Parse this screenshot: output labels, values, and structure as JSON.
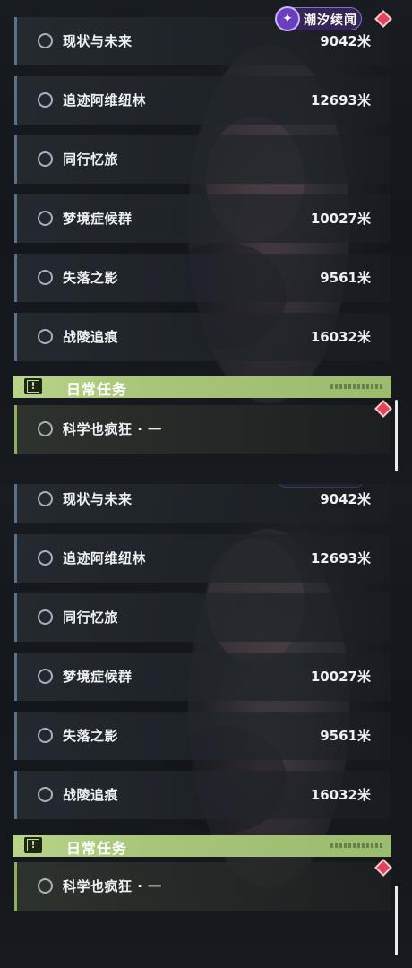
{
  "app_badge": {
    "label": "潮汐续闻",
    "logo_glyph": "✦"
  },
  "section": {
    "title": "日常任务",
    "icon_glyph": "!"
  },
  "quests": [
    {
      "name": "现状与未来",
      "distance": "9042米"
    },
    {
      "name": "追迹阿维纽林",
      "distance": "12693米"
    },
    {
      "name": "同行忆旅",
      "distance": ""
    },
    {
      "name": "梦境症候群",
      "distance": "10027米"
    },
    {
      "name": "失落之影",
      "distance": "9561米"
    },
    {
      "name": "战陵追痕",
      "distance": "16032米"
    }
  ],
  "daily_quests": [
    {
      "name": "科学也疯狂 · 一",
      "distance": ""
    }
  ],
  "colors": {
    "row_accent": "#5a7288",
    "daily_accent": "#8fae5e",
    "section_header": "#b9d48a",
    "marker": "#e0445a",
    "badge": "#6a3fbf"
  },
  "icons": {
    "quest_status": "radio-circle-icon",
    "section": "exclamation-icon",
    "tracking_marker": "diamond-marker-icon",
    "badge_logo": "sparkle-logo-icon"
  }
}
